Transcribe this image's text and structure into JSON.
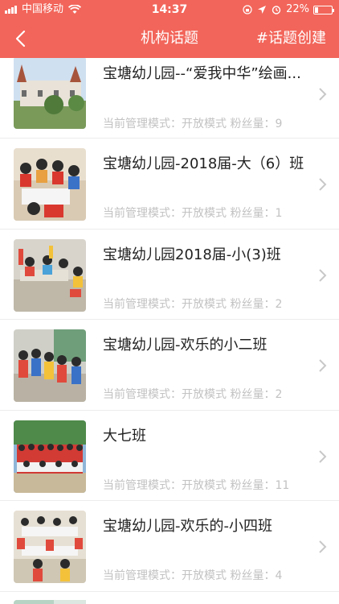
{
  "status_bar": {
    "carrier": "中国移动",
    "time": "14:37",
    "battery": "22%",
    "battery_level": 0.22
  },
  "nav": {
    "title": "机构话题",
    "action": "#话题创建",
    "back_icon": "chevron-left-icon"
  },
  "items": [
    {
      "title": "宝塘幼儿园--“爱我中华”绘画...",
      "meta": "当前管理模式：开放模式 粉丝量：9"
    },
    {
      "title": "宝塘幼儿园-2018届-大（6）班",
      "meta": "当前管理模式：开放模式 粉丝量：1"
    },
    {
      "title": "宝塘幼儿园2018届-小(3)班",
      "meta": "当前管理模式：开放模式 粉丝量：2"
    },
    {
      "title": "宝塘幼儿园-欢乐的小二班",
      "meta": "当前管理模式：开放模式 粉丝量：2"
    },
    {
      "title": "大七班",
      "meta": "当前管理模式：开放模式 粉丝量：11"
    },
    {
      "title": "宝塘幼儿园-欢乐的-小四班",
      "meta": "当前管理模式：开放模式 粉丝量：4"
    }
  ],
  "colors": {
    "accent": "#f2655a",
    "meta_text": "#c2c2c2"
  }
}
